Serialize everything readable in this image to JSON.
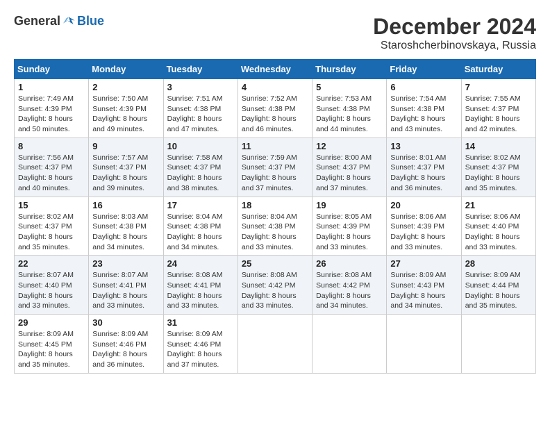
{
  "logo": {
    "general": "General",
    "blue": "Blue"
  },
  "title": {
    "month": "December 2024",
    "location": "Staroshcherbinovskaya, Russia"
  },
  "weekdays": [
    "Sunday",
    "Monday",
    "Tuesday",
    "Wednesday",
    "Thursday",
    "Friday",
    "Saturday"
  ],
  "weeks": [
    [
      {
        "day": "1",
        "sunrise": "7:49 AM",
        "sunset": "4:39 PM",
        "daylight": "8 hours and 50 minutes."
      },
      {
        "day": "2",
        "sunrise": "7:50 AM",
        "sunset": "4:39 PM",
        "daylight": "8 hours and 49 minutes."
      },
      {
        "day": "3",
        "sunrise": "7:51 AM",
        "sunset": "4:38 PM",
        "daylight": "8 hours and 47 minutes."
      },
      {
        "day": "4",
        "sunrise": "7:52 AM",
        "sunset": "4:38 PM",
        "daylight": "8 hours and 46 minutes."
      },
      {
        "day": "5",
        "sunrise": "7:53 AM",
        "sunset": "4:38 PM",
        "daylight": "8 hours and 44 minutes."
      },
      {
        "day": "6",
        "sunrise": "7:54 AM",
        "sunset": "4:38 PM",
        "daylight": "8 hours and 43 minutes."
      },
      {
        "day": "7",
        "sunrise": "7:55 AM",
        "sunset": "4:37 PM",
        "daylight": "8 hours and 42 minutes."
      }
    ],
    [
      {
        "day": "8",
        "sunrise": "7:56 AM",
        "sunset": "4:37 PM",
        "daylight": "8 hours and 40 minutes."
      },
      {
        "day": "9",
        "sunrise": "7:57 AM",
        "sunset": "4:37 PM",
        "daylight": "8 hours and 39 minutes."
      },
      {
        "day": "10",
        "sunrise": "7:58 AM",
        "sunset": "4:37 PM",
        "daylight": "8 hours and 38 minutes."
      },
      {
        "day": "11",
        "sunrise": "7:59 AM",
        "sunset": "4:37 PM",
        "daylight": "8 hours and 37 minutes."
      },
      {
        "day": "12",
        "sunrise": "8:00 AM",
        "sunset": "4:37 PM",
        "daylight": "8 hours and 37 minutes."
      },
      {
        "day": "13",
        "sunrise": "8:01 AM",
        "sunset": "4:37 PM",
        "daylight": "8 hours and 36 minutes."
      },
      {
        "day": "14",
        "sunrise": "8:02 AM",
        "sunset": "4:37 PM",
        "daylight": "8 hours and 35 minutes."
      }
    ],
    [
      {
        "day": "15",
        "sunrise": "8:02 AM",
        "sunset": "4:37 PM",
        "daylight": "8 hours and 35 minutes."
      },
      {
        "day": "16",
        "sunrise": "8:03 AM",
        "sunset": "4:38 PM",
        "daylight": "8 hours and 34 minutes."
      },
      {
        "day": "17",
        "sunrise": "8:04 AM",
        "sunset": "4:38 PM",
        "daylight": "8 hours and 34 minutes."
      },
      {
        "day": "18",
        "sunrise": "8:04 AM",
        "sunset": "4:38 PM",
        "daylight": "8 hours and 33 minutes."
      },
      {
        "day": "19",
        "sunrise": "8:05 AM",
        "sunset": "4:39 PM",
        "daylight": "8 hours and 33 minutes."
      },
      {
        "day": "20",
        "sunrise": "8:06 AM",
        "sunset": "4:39 PM",
        "daylight": "8 hours and 33 minutes."
      },
      {
        "day": "21",
        "sunrise": "8:06 AM",
        "sunset": "4:40 PM",
        "daylight": "8 hours and 33 minutes."
      }
    ],
    [
      {
        "day": "22",
        "sunrise": "8:07 AM",
        "sunset": "4:40 PM",
        "daylight": "8 hours and 33 minutes."
      },
      {
        "day": "23",
        "sunrise": "8:07 AM",
        "sunset": "4:41 PM",
        "daylight": "8 hours and 33 minutes."
      },
      {
        "day": "24",
        "sunrise": "8:08 AM",
        "sunset": "4:41 PM",
        "daylight": "8 hours and 33 minutes."
      },
      {
        "day": "25",
        "sunrise": "8:08 AM",
        "sunset": "4:42 PM",
        "daylight": "8 hours and 33 minutes."
      },
      {
        "day": "26",
        "sunrise": "8:08 AM",
        "sunset": "4:42 PM",
        "daylight": "8 hours and 34 minutes."
      },
      {
        "day": "27",
        "sunrise": "8:09 AM",
        "sunset": "4:43 PM",
        "daylight": "8 hours and 34 minutes."
      },
      {
        "day": "28",
        "sunrise": "8:09 AM",
        "sunset": "4:44 PM",
        "daylight": "8 hours and 35 minutes."
      }
    ],
    [
      {
        "day": "29",
        "sunrise": "8:09 AM",
        "sunset": "4:45 PM",
        "daylight": "8 hours and 35 minutes."
      },
      {
        "day": "30",
        "sunrise": "8:09 AM",
        "sunset": "4:46 PM",
        "daylight": "8 hours and 36 minutes."
      },
      {
        "day": "31",
        "sunrise": "8:09 AM",
        "sunset": "4:46 PM",
        "daylight": "8 hours and 37 minutes."
      },
      null,
      null,
      null,
      null
    ]
  ]
}
